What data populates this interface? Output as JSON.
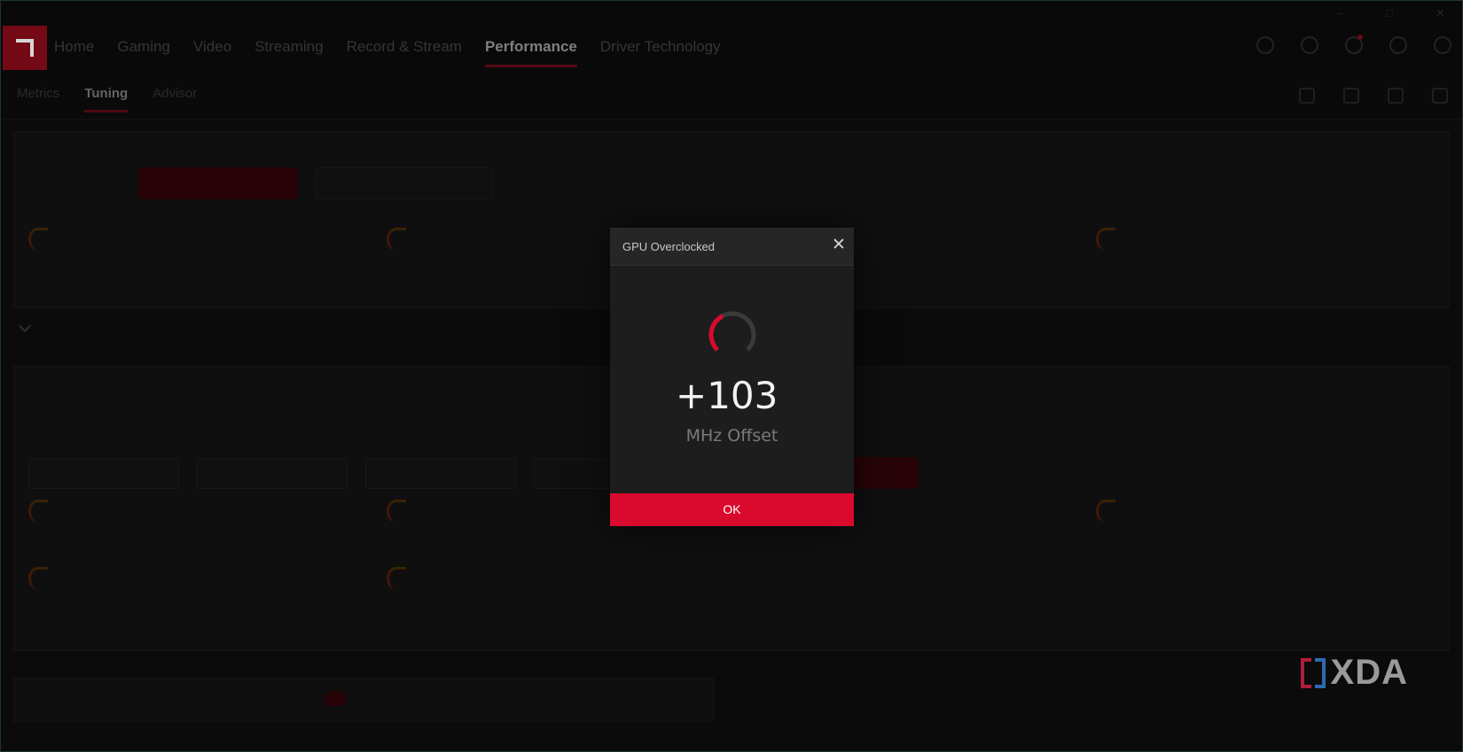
{
  "nav": {
    "items": [
      {
        "label": "Home"
      },
      {
        "label": "Gaming"
      },
      {
        "label": "Video"
      },
      {
        "label": "Streaming"
      },
      {
        "label": "Record & Stream"
      },
      {
        "label": "Performance",
        "active": true
      },
      {
        "label": "Driver Technology"
      }
    ]
  },
  "subtabs": [
    {
      "label": "Metrics"
    },
    {
      "label": "Tuning",
      "active": true
    },
    {
      "label": "Advisor"
    }
  ],
  "modal": {
    "title": "GPU Overclocked",
    "value": "+103",
    "unit": "MHz Offset",
    "gauge_fraction": 0.4,
    "ok_label": "OK"
  },
  "watermark": {
    "brand": "XDA"
  },
  "colors": {
    "accent": "#d90a2d",
    "modal_bg": "#1d1d1d",
    "modal_header": "#262626"
  }
}
